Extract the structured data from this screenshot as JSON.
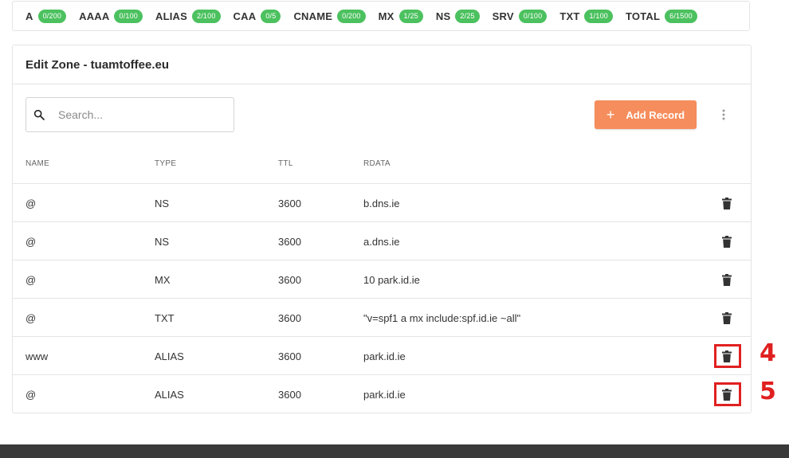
{
  "quotas": [
    {
      "label": "A",
      "value": "0/200"
    },
    {
      "label": "AAAA",
      "value": "0/100"
    },
    {
      "label": "ALIAS",
      "value": "2/100"
    },
    {
      "label": "CAA",
      "value": "0/5"
    },
    {
      "label": "CNAME",
      "value": "0/200"
    },
    {
      "label": "MX",
      "value": "1/25"
    },
    {
      "label": "NS",
      "value": "2/25"
    },
    {
      "label": "SRV",
      "value": "0/100"
    },
    {
      "label": "TXT",
      "value": "1/100"
    },
    {
      "label": "TOTAL",
      "value": "6/1500"
    }
  ],
  "zone": {
    "title": "Edit Zone - tuamtoffee.eu"
  },
  "search": {
    "placeholder": "Search...",
    "value": ""
  },
  "toolbar": {
    "add_record_label": "Add Record",
    "plus": "+"
  },
  "table": {
    "headers": {
      "name": "NAME",
      "type": "TYPE",
      "ttl": "TTL",
      "rdata": "RDATA"
    },
    "rows": [
      {
        "name": "@",
        "type": "NS",
        "ttl": "3600",
        "rdata": "b.dns.ie"
      },
      {
        "name": "@",
        "type": "NS",
        "ttl": "3600",
        "rdata": "a.dns.ie"
      },
      {
        "name": "@",
        "type": "MX",
        "ttl": "3600",
        "rdata": "10 park.id.ie"
      },
      {
        "name": "@",
        "type": "TXT",
        "ttl": "3600",
        "rdata": "\"v=spf1 a mx include:spf.id.ie ~all\""
      },
      {
        "name": "www",
        "type": "ALIAS",
        "ttl": "3600",
        "rdata": "park.id.ie"
      },
      {
        "name": "@",
        "type": "ALIAS",
        "ttl": "3600",
        "rdata": "park.id.ie"
      }
    ]
  },
  "annotations": {
    "first": "4",
    "second": "5"
  },
  "icons": {
    "search": "search-icon",
    "more": "more-vert-icon",
    "delete": "trash-icon"
  },
  "colors": {
    "badge": "#4cc15f",
    "accent": "#f68d5c",
    "annotation": "#e02020"
  }
}
